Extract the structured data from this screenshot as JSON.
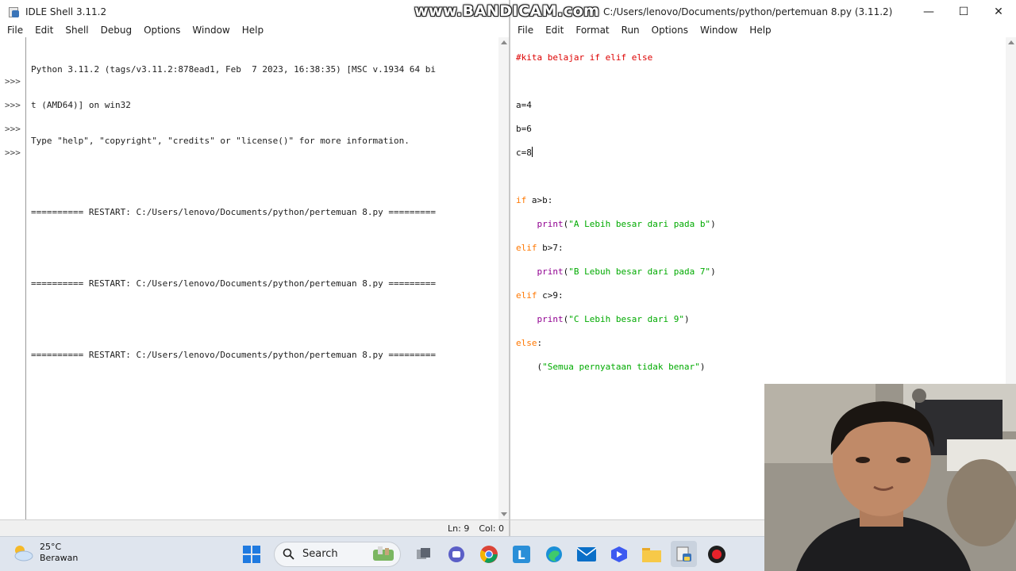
{
  "shell": {
    "title": "IDLE Shell 3.11.2",
    "menu": [
      "File",
      "Edit",
      "Shell",
      "Debug",
      "Options",
      "Window",
      "Help"
    ],
    "prompts": [
      ">>>",
      ">>>",
      ">>>",
      ">>>"
    ],
    "lines": [
      "Python 3.11.2 (tags/v3.11.2:878ead1, Feb  7 2023, 16:38:35) [MSC v.1934 64 bi",
      "t (AMD64)] on win32",
      "Type \"help\", \"copyright\", \"credits\" or \"license()\" for more information.",
      "",
      "========== RESTART: C:/Users/lenovo/Documents/python/pertemuan 8.py =========",
      "",
      "========== RESTART: C:/Users/lenovo/Documents/python/pertemuan 8.py =========",
      "",
      "========== RESTART: C:/Users/lenovo/Documents/python/pertemuan 8.py ========="
    ],
    "status": {
      "line": "Ln: 9",
      "col": "Col: 0"
    }
  },
  "editor": {
    "title": "C:/Users/lenovo/Documents/python/pertemuan 8.py (3.11.2)",
    "menu": [
      "File",
      "Edit",
      "Format",
      "Run",
      "Options",
      "Window",
      "Help"
    ],
    "code": {
      "comment": "#kita belajar if elif else",
      "a": "a=4",
      "b": "b=6",
      "c": "c=8",
      "if_kw": "if",
      "if_cond": " a>b:",
      "print1_fn": "print",
      "print1_str": "\"A Lebih besar dari pada b\"",
      "elif1_kw": "elif",
      "elif1_cond": " b>7:",
      "print2_fn": "print",
      "print2_str": "\"B Lebuh besar dari pada 7\"",
      "elif2_kw": "elif",
      "elif2_cond": " c>9:",
      "print3_fn": "print",
      "print3_str": "\"C Lebih besar dari 9\"",
      "else_kw": "else",
      "else_colon": ":",
      "last_str": "\"Semua pernyataan tidak benar\""
    }
  },
  "watermark": "www.BANDICAM.com",
  "taskbar": {
    "temperature": "25°C",
    "condition": "Berawan",
    "search_label": "Search",
    "icons": [
      "windows-start",
      "search",
      "widgets",
      "task-view",
      "teams",
      "chrome",
      "lenovo-l",
      "edge",
      "mail",
      "video-editor",
      "file-explorer",
      "python-idle",
      "record"
    ]
  },
  "colors": {
    "comment": "#dd0000",
    "keyword": "#ff7700",
    "builtin": "#900090",
    "string": "#00aa00"
  }
}
